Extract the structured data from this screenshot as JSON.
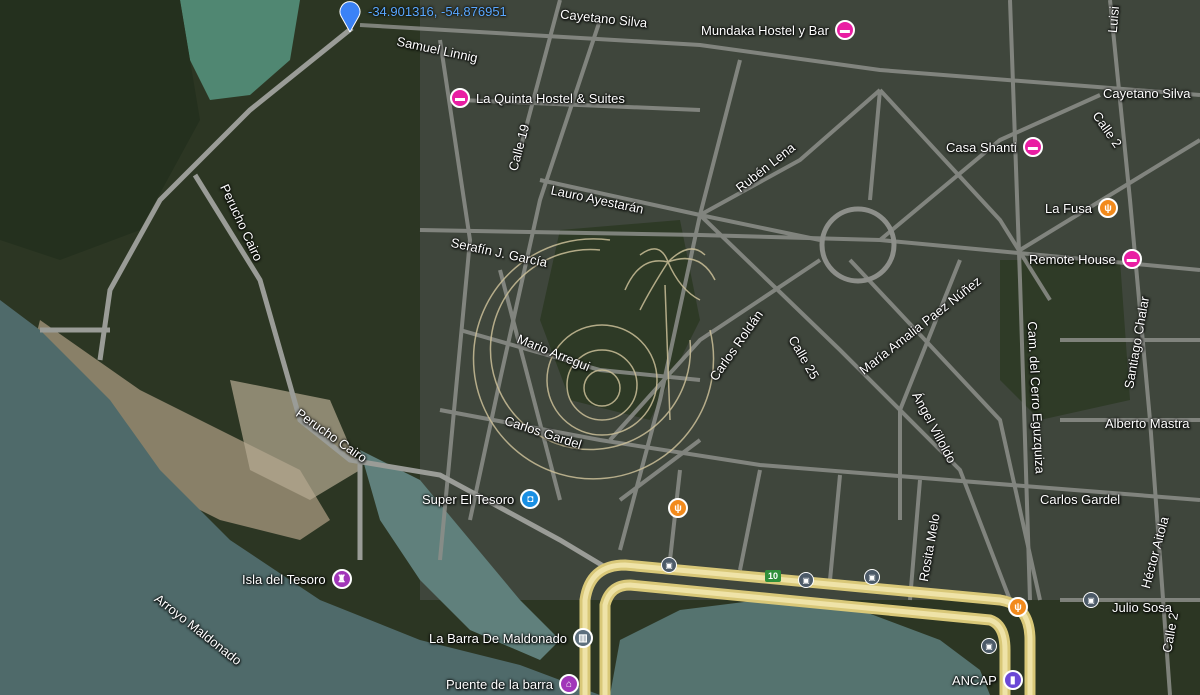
{
  "location": {
    "coordinates": "-34.901316, -54.876951"
  },
  "streets": {
    "cayetano_silva_top": "Cayetano Silva",
    "cayetano_silva_right": "Cayetano Silva",
    "samuel_linnig": "Samuel Linnig",
    "calle_19": "Calle 19",
    "lauro_ayestaran": "Lauro Ayestarán",
    "ruben_lena": "Rubén Lena",
    "serafin_garcia": "Serafín J. García",
    "perucho_cairo_upper": "Perucho Cairo",
    "perucho_cairo_lower": "Perucho Cairo",
    "mario_arregui": "Mario Arregui",
    "carlos_roldan": "Carlos Roldán",
    "calle_25": "Calle 25",
    "maria_amalia": "María Amalia Paez Núñez",
    "angel_villoldo": "Ángel Villoldo",
    "carlos_gardel_left": "Carlos Gardel",
    "carlos_gardel_right": "Carlos Gardel",
    "cam_cerro": "Cam. del Cerro Eguzquiza",
    "calle_2_top": "Calle 2",
    "calle_2_bottom": "Calle 2",
    "santiago_chalar": "Santiago Chalar",
    "alberto_mastra": "Alberto Mastra",
    "rosita_melo": "Rosita Melo",
    "hector_aitola": "Héctor Aitola",
    "julio_sosa": "Julio Sosa",
    "arroyo_maldonado": "Arroyo Maldonado",
    "luisi": "Luisi",
    "route_10": "10"
  },
  "places": {
    "mundaka": "Mundaka Hostel y Bar",
    "la_quinta": "La Quinta Hostel & Suites",
    "casa_shanti": "Casa Shanti",
    "la_fusa": "La Fusa",
    "remote_house": "Remote House",
    "super_el_tesoro": "Super El Tesoro",
    "isla_del_tesoro": "Isla del Tesoro",
    "la_barra": "La Barra De Maldonado",
    "puente": "Puente de la barra",
    "ancap": "ANCAP"
  },
  "icons": {
    "hotel": "bed-icon",
    "restaurant": "fork-knife-icon",
    "shopping": "shopping-bag-icon",
    "park": "attraction-icon",
    "museum": "museum-icon",
    "gas": "gas-station-icon",
    "bus": "bus-stop-icon",
    "location": "location-pin-icon"
  },
  "colors": {
    "hotel": "#e91ea3",
    "restaurant": "#f28a1c",
    "shopping": "#1a8fe3",
    "attraction": "#a136b9",
    "road_main": "#e9d98c",
    "water": "#4c6a6b"
  }
}
